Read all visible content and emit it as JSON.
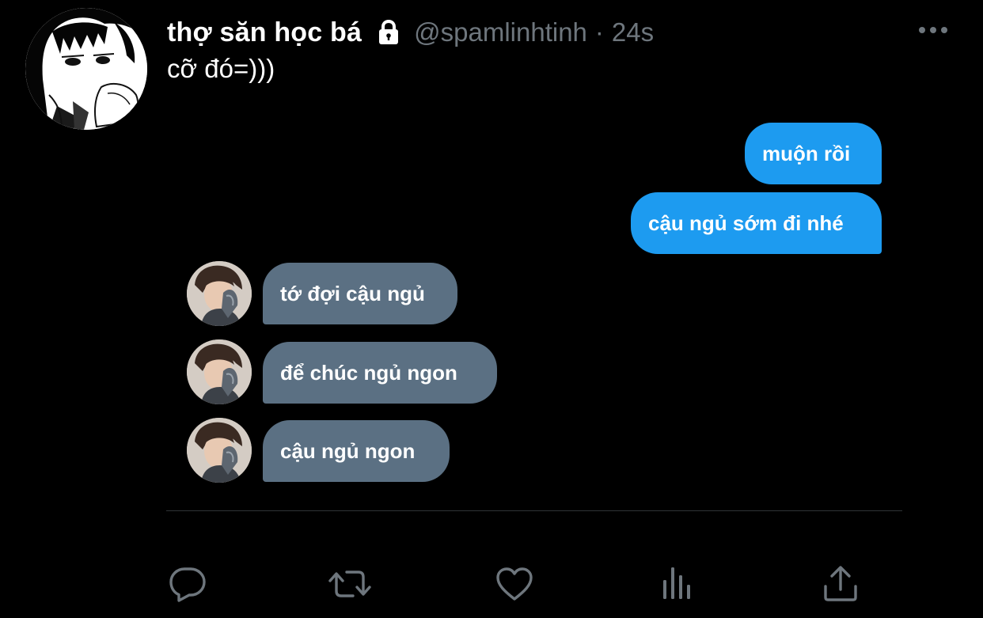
{
  "tweet": {
    "display_name": "thợ săn học bá",
    "lock_icon": "lock-icon",
    "handle": "@spamlinhtinh",
    "separator": "·",
    "time": "24s",
    "text": "cỡ đó=)))",
    "more_icon": "more-horizontal-icon"
  },
  "dm": {
    "messages": [
      {
        "side": "sent",
        "text": "muộn rồi"
      },
      {
        "side": "sent",
        "text": "cậu ngủ sớm đi nhé"
      },
      {
        "side": "received",
        "text": "tớ đợi cậu ngủ"
      },
      {
        "side": "received",
        "text": "để chúc ngủ ngon"
      },
      {
        "side": "received",
        "text": "cậu ngủ ngon"
      }
    ],
    "colors": {
      "sent": "#1d9bf0",
      "received": "#5b7083"
    }
  },
  "actions": [
    {
      "icon": "reply-icon"
    },
    {
      "icon": "retweet-icon"
    },
    {
      "icon": "like-icon"
    },
    {
      "icon": "analytics-icon"
    },
    {
      "icon": "share-icon"
    }
  ],
  "colors": {
    "background": "#000000",
    "secondary_text": "#6e767d",
    "primary_text": "#ffffff"
  }
}
